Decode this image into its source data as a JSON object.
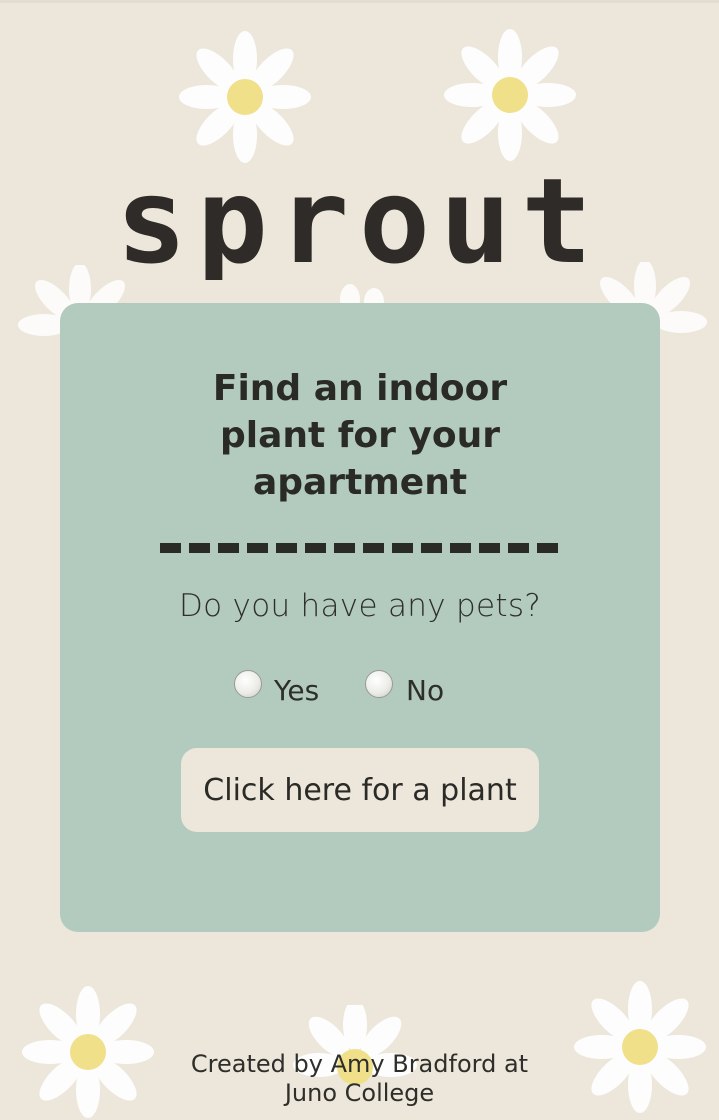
{
  "logo": {
    "text": "sprout"
  },
  "card": {
    "heading_lines": [
      "Find an indoor",
      "plant for your",
      "apartment"
    ],
    "question": "Do you have any pets?",
    "options": [
      {
        "label": "Yes",
        "checked": false
      },
      {
        "label": "No",
        "checked": false
      }
    ],
    "button_label": "Click here for a plant"
  },
  "footer": {
    "lines": [
      "Created by Amy Bradford at",
      "Juno College"
    ]
  },
  "colors": {
    "background": "#ede7db",
    "card": "#b2cbbe",
    "text": "#2a2a26",
    "daisy_center": "#f0e08a"
  },
  "icons": {
    "decoration": "daisy-icon"
  }
}
